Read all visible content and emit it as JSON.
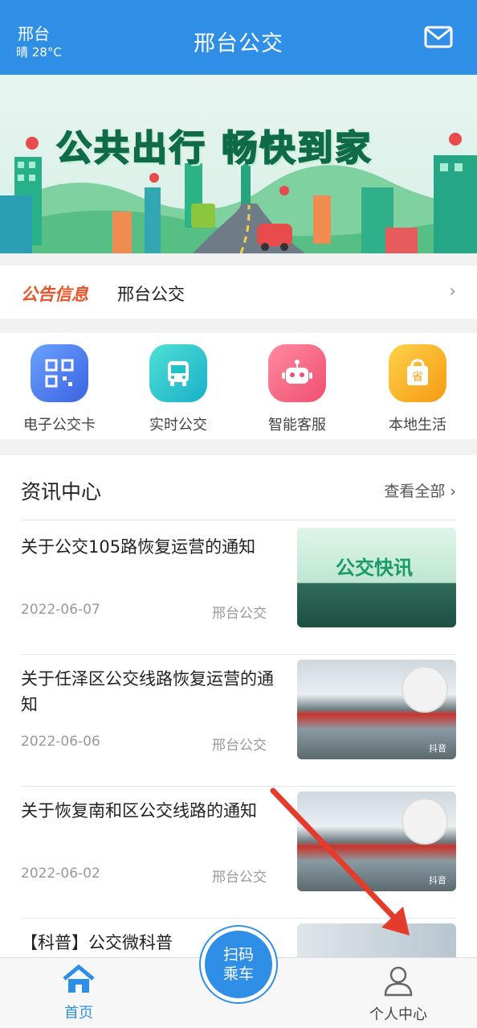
{
  "header": {
    "city": "邢台",
    "weather": "晴 28°C",
    "title": "邢台公交",
    "icons": {
      "mail": "mail-icon"
    }
  },
  "banner": {
    "slogan": "公共出行 畅快到家"
  },
  "notice": {
    "tag": "公告信息",
    "text": "邢台公交",
    "icon": "chevron-right-icon"
  },
  "services": [
    {
      "label": "电子公交卡",
      "icon": "qr-card-icon",
      "color": "#4b7af0"
    },
    {
      "label": "实时公交",
      "icon": "bus-icon",
      "color": "#20c3c9"
    },
    {
      "label": "智能客服",
      "icon": "robot-icon",
      "color": "#f05a78"
    },
    {
      "label": "本地生活",
      "icon": "shopping-bag-icon",
      "color": "#f5a312"
    }
  ],
  "news": {
    "title": "资讯中心",
    "more": "查看全部",
    "items": [
      {
        "title": "关于公交105路恢复运营的通知",
        "date": "2022-06-07",
        "source": "邢台公交",
        "image_caption": "公交快讯"
      },
      {
        "title": "关于任泽区公交线路恢复运营的通知",
        "date": "2022-06-06",
        "source": "邢台公交",
        "image_caption": "抖音"
      },
      {
        "title": "关于恢复南和区公交线路的通知",
        "date": "2022-06-02",
        "source": "邢台公交",
        "image_caption": "抖音"
      },
      {
        "title": "【科普】公交微科普",
        "date": "",
        "source": "",
        "image_caption": ""
      }
    ]
  },
  "bottom_nav": {
    "home": "首页",
    "scan_line1": "扫码",
    "scan_line2": "乘车",
    "me": "个人中心"
  },
  "colors": {
    "primary": "#2f8fe6",
    "notice_tag": "#e8552a",
    "annotation_arrow": "#e53b2c"
  }
}
